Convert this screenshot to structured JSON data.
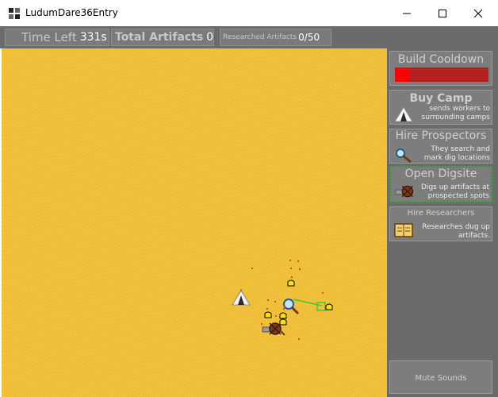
{
  "window": {
    "title": "LudumDare36Entry"
  },
  "hud": {
    "time_label": "Time Left",
    "time_value": "331s",
    "artifacts_label": "Total Artifacts",
    "artifacts_value": "0",
    "researched_label": "Researched Artifacts",
    "researched_value": "0/50"
  },
  "sidebar": {
    "build_cooldown": {
      "label": "Build Cooldown",
      "progress": 0.15
    },
    "buy_camp": {
      "title": "Buy Camp",
      "desc": [
        "sends workers to",
        "surrounding camps"
      ]
    },
    "hire_prospectors": {
      "title": "Hire Prospectors",
      "desc": [
        "They search and",
        "mark dig locations"
      ]
    },
    "open_digsite": {
      "title": "Open Digsite",
      "desc": [
        "Digs up artifacts at",
        "prospected spots"
      ]
    },
    "hire_researchers": {
      "title": "Hire Researchers",
      "desc": [
        "Researches dug up",
        "artifacts."
      ]
    },
    "mute": {
      "label": "Mute Sounds"
    }
  },
  "colors": {
    "sand": "#f2c33b",
    "panel": "#6b6b6b",
    "cooldown_bar": "#b52020",
    "cooldown_fill": "#ff0000",
    "selection": "#2aa02a"
  },
  "icons": {
    "camp": "tent-icon",
    "prospector": "magnifier-pickaxe-icon",
    "digsite": "cart-shovel-icon",
    "researcher": "book-icon"
  }
}
